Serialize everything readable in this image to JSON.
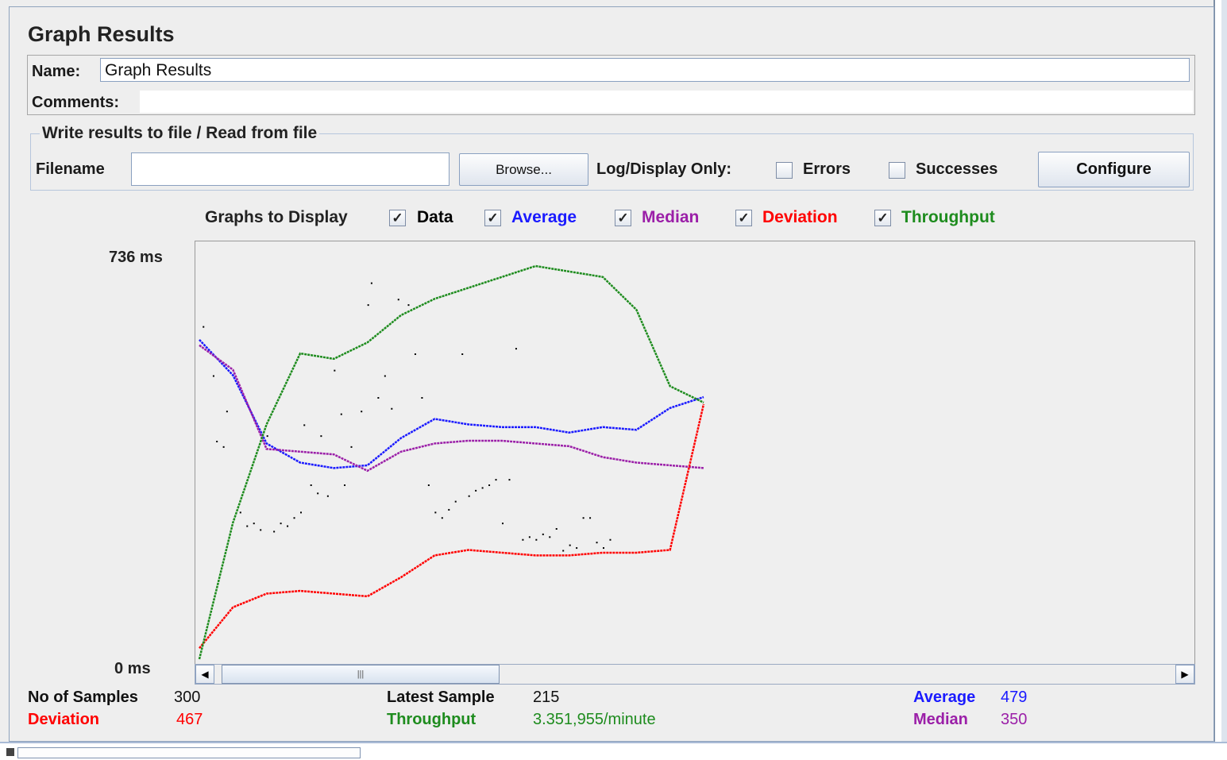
{
  "panel_title": "Graph Results",
  "name_label": "Name:",
  "name_value": "Graph Results",
  "comments_label": "Comments:",
  "file_section": {
    "legend": "Write results to file / Read from file",
    "filename_label": "Filename",
    "filename_value": "",
    "browse_label": "Browse...",
    "log_display_label": "Log/Display Only:",
    "errors_label": "Errors",
    "errors_checked": false,
    "successes_label": "Successes",
    "successes_checked": false,
    "configure_label": "Configure"
  },
  "graphs": {
    "label": "Graphs to Display",
    "items": [
      {
        "label": "Data",
        "checked": true,
        "color": "#000000"
      },
      {
        "label": "Average",
        "checked": true,
        "color": "#1a1aff"
      },
      {
        "label": "Median",
        "checked": true,
        "color": "#9b1fa8"
      },
      {
        "label": "Deviation",
        "checked": true,
        "color": "#ff0000"
      },
      {
        "label": "Throughput",
        "checked": true,
        "color": "#1e8c1e"
      }
    ]
  },
  "y_axis": {
    "max_label": "736  ms",
    "min_label": "0  ms"
  },
  "stats": {
    "samples_label": "No of Samples",
    "samples_value": "300",
    "latest_label": "Latest Sample",
    "latest_value": "215",
    "average_label": "Average",
    "average_value": "479",
    "deviation_label": "Deviation",
    "deviation_value": "467",
    "throughput_label": "Throughput",
    "throughput_value": "3.351,955/minute",
    "median_label": "Median",
    "median_value": "350"
  },
  "chart_data": {
    "type": "line",
    "ylim": [
      0,
      736
    ],
    "x": [
      0,
      20,
      40,
      60,
      80,
      100,
      120,
      140,
      160,
      180,
      200,
      220,
      240,
      260,
      280,
      300
    ],
    "series": [
      {
        "name": "Average",
        "values": [
          585,
          520,
          395,
          360,
          350,
          355,
          405,
          440,
          430,
          425,
          425,
          415,
          425,
          420,
          460,
          480
        ]
      },
      {
        "name": "Median",
        "values": [
          575,
          530,
          385,
          380,
          375,
          345,
          380,
          395,
          400,
          400,
          395,
          390,
          370,
          360,
          355,
          350
        ]
      },
      {
        "name": "Deviation",
        "values": [
          20,
          95,
          120,
          125,
          120,
          115,
          150,
          190,
          200,
          195,
          190,
          190,
          195,
          195,
          200,
          467
        ]
      },
      {
        "name": "Throughput",
        "values": [
          0,
          250,
          430,
          560,
          550,
          580,
          630,
          660,
          680,
          700,
          720,
          710,
          700,
          640,
          500,
          470
        ]
      }
    ],
    "data_points": [
      [
        2,
        610
      ],
      [
        8,
        520
      ],
      [
        10,
        400
      ],
      [
        14,
        390
      ],
      [
        16,
        455
      ],
      [
        24,
        270
      ],
      [
        28,
        245
      ],
      [
        32,
        250
      ],
      [
        36,
        238
      ],
      [
        40,
        410
      ],
      [
        44,
        235
      ],
      [
        48,
        250
      ],
      [
        52,
        245
      ],
      [
        56,
        260
      ],
      [
        60,
        270
      ],
      [
        62,
        430
      ],
      [
        66,
        320
      ],
      [
        70,
        305
      ],
      [
        72,
        410
      ],
      [
        76,
        300
      ],
      [
        80,
        530
      ],
      [
        84,
        450
      ],
      [
        86,
        320
      ],
      [
        90,
        390
      ],
      [
        96,
        455
      ],
      [
        100,
        650
      ],
      [
        102,
        690
      ],
      [
        106,
        480
      ],
      [
        110,
        520
      ],
      [
        114,
        460
      ],
      [
        118,
        660
      ],
      [
        124,
        650
      ],
      [
        128,
        560
      ],
      [
        132,
        480
      ],
      [
        136,
        320
      ],
      [
        140,
        270
      ],
      [
        144,
        260
      ],
      [
        148,
        275
      ],
      [
        152,
        290
      ],
      [
        156,
        560
      ],
      [
        160,
        300
      ],
      [
        164,
        310
      ],
      [
        168,
        315
      ],
      [
        172,
        320
      ],
      [
        176,
        330
      ],
      [
        180,
        250
      ],
      [
        184,
        330
      ],
      [
        188,
        570
      ],
      [
        192,
        220
      ],
      [
        196,
        225
      ],
      [
        200,
        220
      ],
      [
        204,
        230
      ],
      [
        208,
        225
      ],
      [
        212,
        240
      ],
      [
        216,
        200
      ],
      [
        220,
        210
      ],
      [
        224,
        205
      ],
      [
        228,
        260
      ],
      [
        232,
        260
      ],
      [
        236,
        215
      ],
      [
        240,
        205
      ],
      [
        244,
        220
      ]
    ]
  }
}
